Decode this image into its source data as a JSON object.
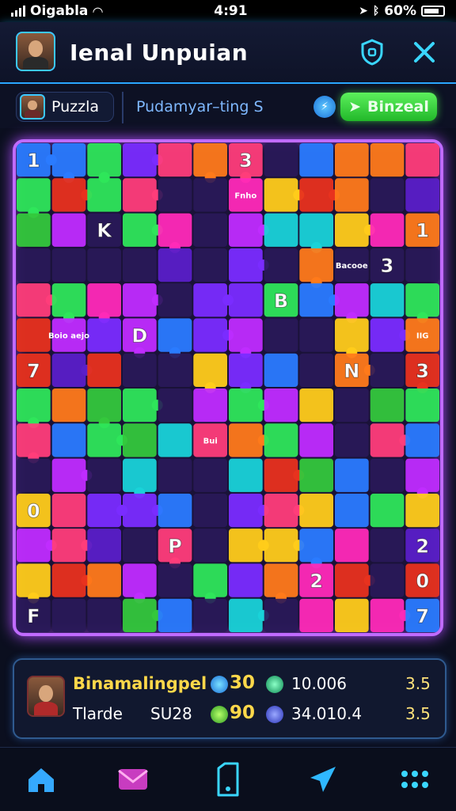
{
  "status": {
    "carrier": "Oigabla",
    "time": "4:91",
    "battery": "60%"
  },
  "header": {
    "title": "Ienal Unpuian"
  },
  "subbar": {
    "chip_label": "Puzzla",
    "subtitle": "Pudamyar–ting S",
    "action_label": "Binzeal"
  },
  "board": {
    "labels": [
      "1",
      "3",
      "Fnho",
      "1",
      "K",
      "3",
      "Bacooe",
      "B",
      "Boio aejo",
      "D",
      "IIG",
      "7",
      "N",
      "3",
      "Bui",
      "0",
      "2",
      "P",
      "2",
      "0",
      "F",
      "7"
    ]
  },
  "panel": {
    "player_name": "Binamalingpel",
    "player_sub": "Tlarde",
    "player_code": "SU28",
    "coin1_value": "30",
    "coin2_value": "90",
    "stat1": "10.006",
    "stat2": "34.010.4",
    "right1": "3.5",
    "right2": "3.5"
  },
  "nav": {
    "items": [
      "home-icon",
      "mail-icon",
      "phone-icon",
      "send-icon",
      "menu-icon"
    ]
  },
  "colors": {
    "accent": "#2aa6ff",
    "board_border": "#c06bff",
    "go_button": "#3fd23f"
  }
}
